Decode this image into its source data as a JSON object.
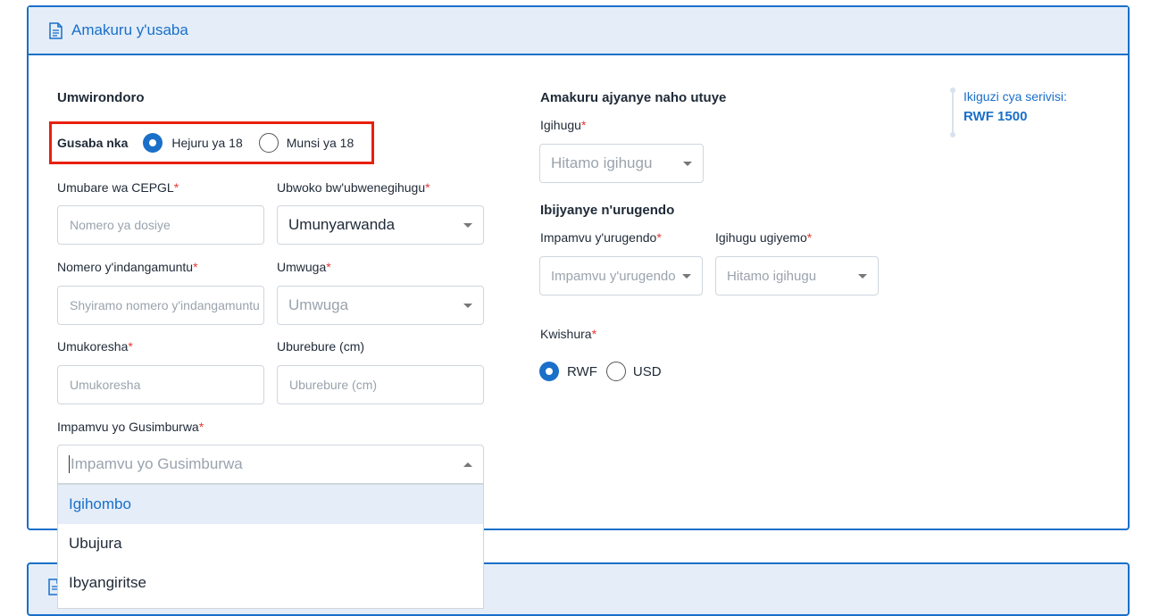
{
  "header": {
    "title": "Amakuru y'usaba",
    "icon": "document-icon"
  },
  "left": {
    "section_title": "Umwirondoro",
    "age": {
      "label": "Gusaba nka",
      "options": [
        "Hejuru ya 18",
        "Munsi ya 18"
      ],
      "selected": "Hejuru ya 18"
    },
    "cepgl": {
      "label": "Umubare wa CEPGL",
      "required": "*",
      "placeholder": "Nomero ya dosiye"
    },
    "nationality": {
      "label": "Ubwoko bw'ubwenegihugu",
      "required": "*",
      "value": "Umunyarwanda"
    },
    "id_number": {
      "label": "Nomero y'indangamuntu",
      "required": "*",
      "placeholder": "Shyiramo nomero y'indangamuntu"
    },
    "gender": {
      "label": "Umwuga",
      "required": "*",
      "placeholder": "Umwuga"
    },
    "employer": {
      "label": "Umukoresha",
      "required": "*",
      "placeholder": "Umukoresha"
    },
    "height": {
      "label": "Uburebure (cm)",
      "placeholder": "Uburebure (cm)"
    },
    "reason": {
      "label": "Impamvu yo Gusimburwa",
      "required": "*",
      "placeholder": "Impamvu yo Gusimburwa",
      "options": [
        "Igihombo",
        "Ubujura",
        "Ibyangiritse"
      ],
      "highlighted": "Igihombo"
    }
  },
  "middle": {
    "residence_title": "Amakuru ajyanye naho utuye",
    "country": {
      "label": "Igihugu",
      "required": "*",
      "placeholder": "Hitamo igihugu"
    },
    "travel_title": "Ibijyanye n'urugendo",
    "travel_reason": {
      "label": "Impamvu y'urugendo",
      "required": "*",
      "placeholder": "Impamvu y'urugendo"
    },
    "destination": {
      "label": "Igihugu ugiyemo",
      "required": "*",
      "placeholder": "Hitamo igihugu"
    },
    "currency": {
      "label": "Kwishura",
      "required": "*",
      "options": [
        "RWF",
        "USD"
      ],
      "selected": "RWF"
    }
  },
  "fee": {
    "label": "Ikiguzi cya serivisi:",
    "amount": "RWF 1500"
  },
  "colors": {
    "primary": "#1a6fc9",
    "header_bg": "#e4edf8",
    "required": "#e53935",
    "highlight": "#e8200e"
  }
}
